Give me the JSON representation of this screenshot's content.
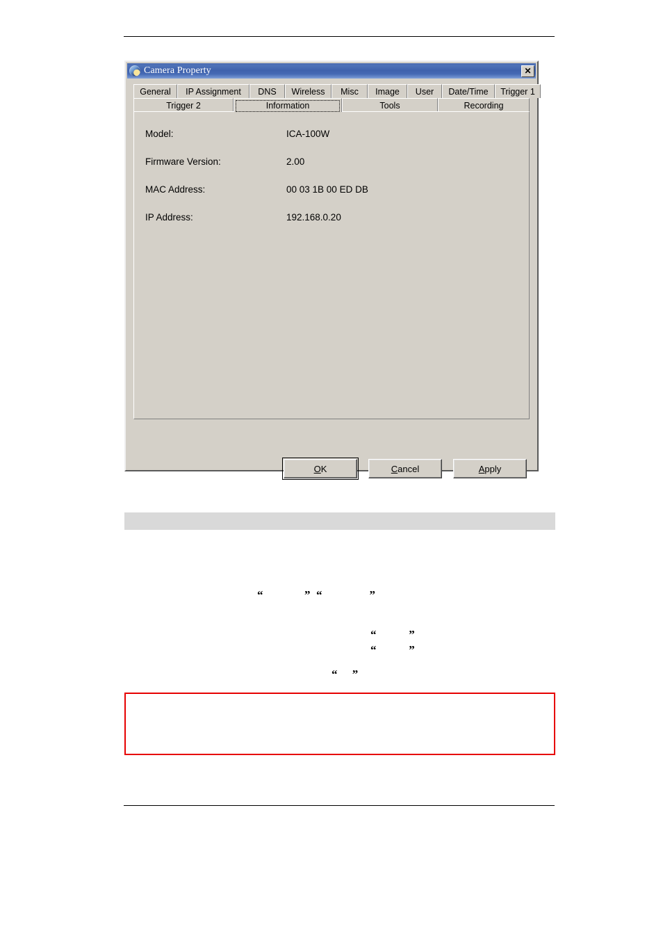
{
  "document": {
    "header_rule": "",
    "footer_rule": "",
    "gray_banner_text": "",
    "quote_lines": [
      "“              ”  “                ”",
      "“           ”",
      "“           ”",
      "“     ”"
    ],
    "callout_box_text": ""
  },
  "dialog": {
    "title": "Camera Property",
    "title_icon": "camera-globe-icon",
    "close_icon": "close-icon",
    "close_label": "✕",
    "colors": {
      "titlebar_start": "#4a6bb0",
      "titlebar_end": "#8aa7d8",
      "face": "#d4d0c8",
      "text": "#000000"
    },
    "tabs": {
      "row1": [
        {
          "label": "General",
          "selected": false
        },
        {
          "label": "IP Assignment",
          "selected": false
        },
        {
          "label": "DNS",
          "selected": false
        },
        {
          "label": "Wireless",
          "selected": false
        },
        {
          "label": "Misc",
          "selected": false
        },
        {
          "label": "Image",
          "selected": false
        },
        {
          "label": "User",
          "selected": false
        },
        {
          "label": "Date/Time",
          "selected": false
        },
        {
          "label": "Trigger 1",
          "selected": false
        }
      ],
      "row2": [
        {
          "label": "Trigger 2",
          "selected": false
        },
        {
          "label": "Information",
          "selected": true
        },
        {
          "label": "Tools",
          "selected": false
        },
        {
          "label": "Recording",
          "selected": false
        }
      ],
      "selected": "Information"
    },
    "information": {
      "rows": [
        {
          "label": "Model:",
          "value": "ICA-100W"
        },
        {
          "label": "Firmware Version:",
          "value": "2.00"
        },
        {
          "label": "MAC Address:",
          "value": "00 03 1B 00 ED DB"
        },
        {
          "label": "IP Address:",
          "value": "192.168.0.20"
        }
      ]
    },
    "buttons": {
      "ok": {
        "label": "OK",
        "accel": "O",
        "default": true
      },
      "cancel": {
        "label": "Cancel",
        "accel": "C",
        "default": false
      },
      "apply": {
        "label": "Apply",
        "accel": "A",
        "default": false
      }
    }
  }
}
